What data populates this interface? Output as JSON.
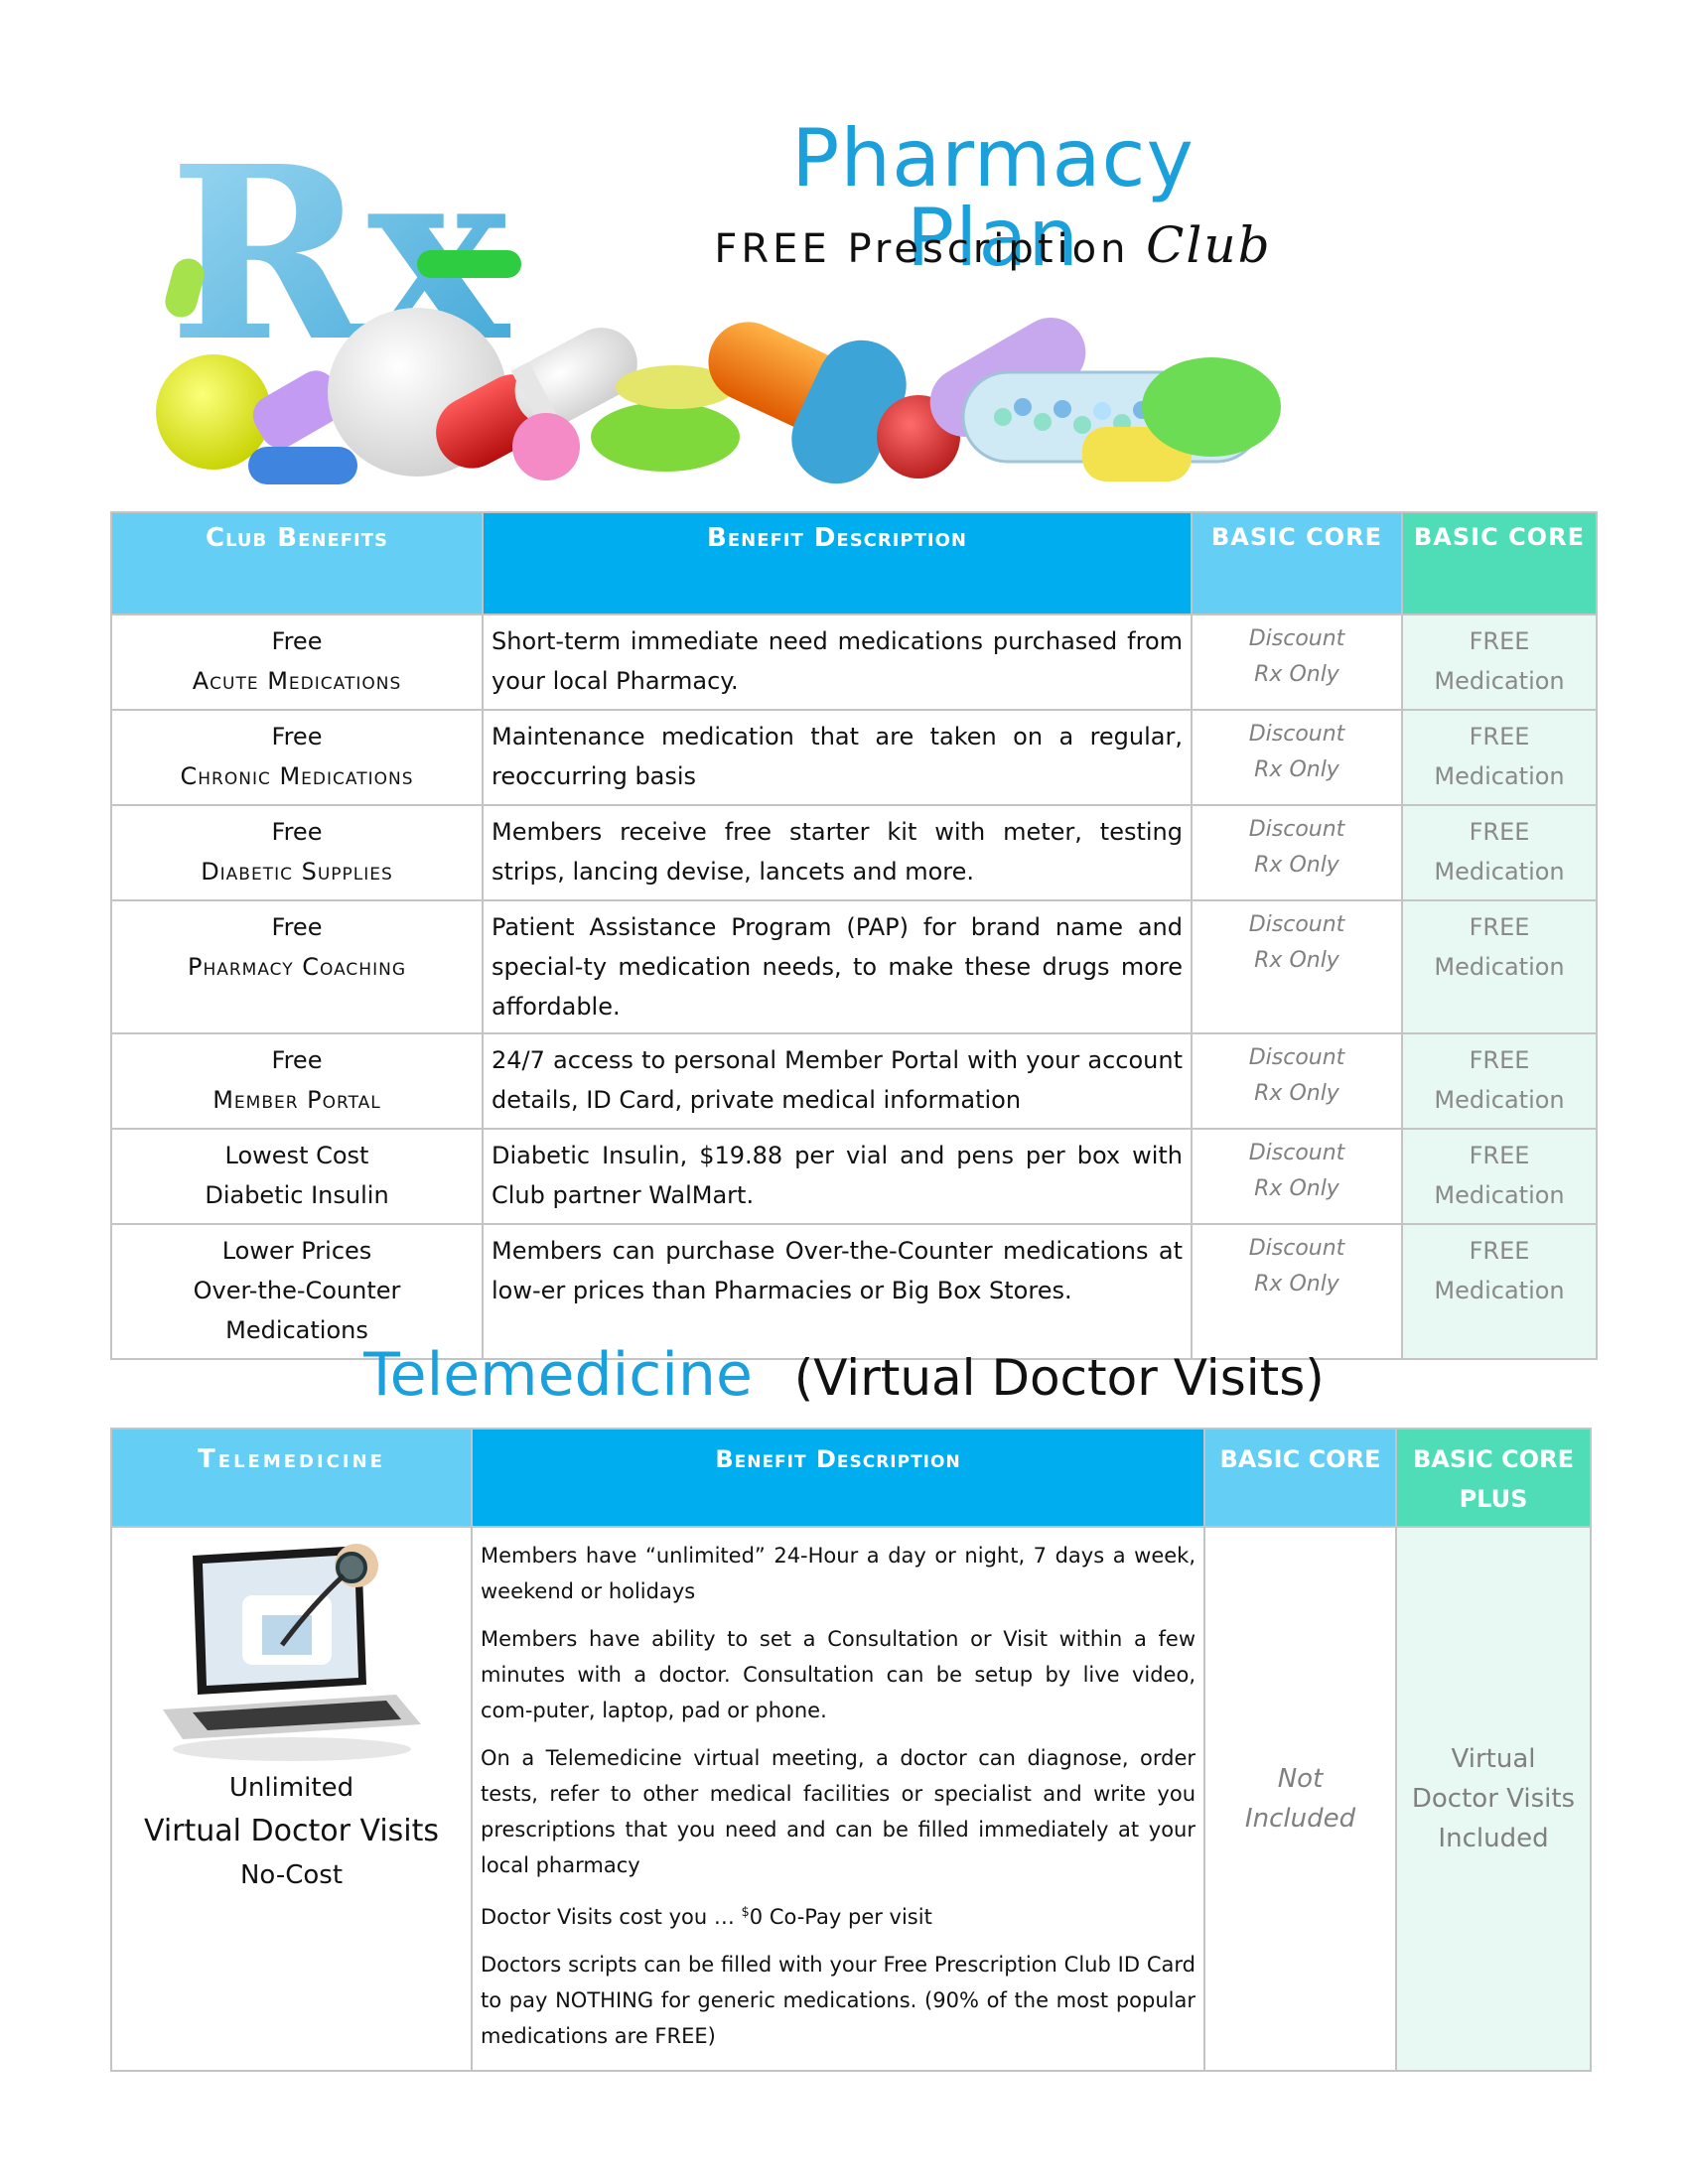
{
  "header": {
    "title": "Pharmacy Plan",
    "subtitle_main": "FREE Prescription",
    "subtitle_script": "Club",
    "hero_logo_text": "Rx"
  },
  "club_table": {
    "headers": {
      "benefits": "Club Benefits",
      "description": "Benefit Description",
      "basic": "BASIC  CORE",
      "core": "BASIC  CORE"
    },
    "rows": [
      {
        "line1": "Free",
        "line2": "Acute Medications",
        "line3": "",
        "description": "Short-term immediate need medications purchased from your local Pharmacy.",
        "basic1": "Discount",
        "basic2": "Rx Only",
        "core1": "FREE",
        "core2": "Medication"
      },
      {
        "line1": "Free",
        "line2": "Chronic  Medications",
        "line3": "",
        "description": "Maintenance medication that are taken on a regular, reoccurring basis",
        "basic1": "Discount",
        "basic2": "Rx Only",
        "core1": "FREE",
        "core2": "Medication"
      },
      {
        "line1": "Free",
        "line2": "Diabetic Supplies",
        "line3": "",
        "description": "Members receive free starter kit with meter, testing strips, lancing devise, lancets and more.",
        "basic1": "Discount",
        "basic2": "Rx Only",
        "core1": "FREE",
        "core2": "Medication"
      },
      {
        "line1": "Free",
        "line2": "Pharmacy Coaching",
        "line3": "",
        "description": "Patient Assistance Program (PAP) for brand name and special-ty medication needs, to make these drugs more affordable.",
        "basic1": "Discount",
        "basic2": "Rx Only",
        "core1": "FREE",
        "core2": "Medication"
      },
      {
        "line1": "Free",
        "line2": "Member Portal",
        "line3": "",
        "description": "24/7 access to personal Member Portal with your account details, ID Card, private medical information",
        "basic1": "Discount",
        "basic2": "Rx Only",
        "core1": "FREE",
        "core2": "Medication"
      },
      {
        "line1": "Lowest Cost",
        "line2": "Diabetic Insulin",
        "line3": "",
        "description": "Diabetic Insulin, $19.88 per vial and pens per box with Club partner WalMart.",
        "basic1": "Discount",
        "basic2": "Rx Only",
        "core1": "FREE",
        "core2": "Medication"
      },
      {
        "line1": "Lower Prices",
        "line2": "Over-the-Counter",
        "line3": "Medications",
        "description": "Members can purchase Over-the-Counter medications at low-er prices than Pharmacies or Big Box Stores.",
        "basic1": "Discount",
        "basic2": "Rx Only",
        "core1": "FREE",
        "core2": "Medication"
      }
    ]
  },
  "telemedicine_heading": {
    "main": "Telemedicine",
    "paren": "(Virtual Doctor Visits)"
  },
  "tele_table": {
    "headers": {
      "telemedicine": "Telemedicine",
      "description": "Benefit Description",
      "basic": "BASIC  CORE",
      "core_line1": "BASIC  CORE",
      "core_line2": "PLUS"
    },
    "left": {
      "line1": "Unlimited",
      "line2": "Virtual Doctor Visits",
      "line3": "No-Cost"
    },
    "paragraphs": [
      "Members have “unlimited” 24-Hour a day or night, 7 days a week, weekend or holidays",
      "Members have ability to set a Consultation or Visit within a few minutes with a doctor.  Consultation can be setup  by live video,  com-puter, laptop, pad or phone.",
      "On a Telemedicine virtual meeting, a doctor can diagnose, order tests, refer to other medical facilities or specialist and write you prescriptions that you need and can be filled immediately at your local pharmacy"
    ],
    "cost_prefix": "Doctor Visits cost you … ",
    "cost_sup": "$",
    "cost_suffix": "0 Co-Pay per visit",
    "last_paragraph": "Doctors scripts can be filled with your Free Prescription Club  ID Card to pay NOTHING for generic medications.  (90% of the most popular medications are FREE)",
    "basic_line1": "Not",
    "basic_line2": "Included",
    "core_line1": "Virtual",
    "core_line2": "Doctor Visits",
    "core_line3": "Included"
  }
}
